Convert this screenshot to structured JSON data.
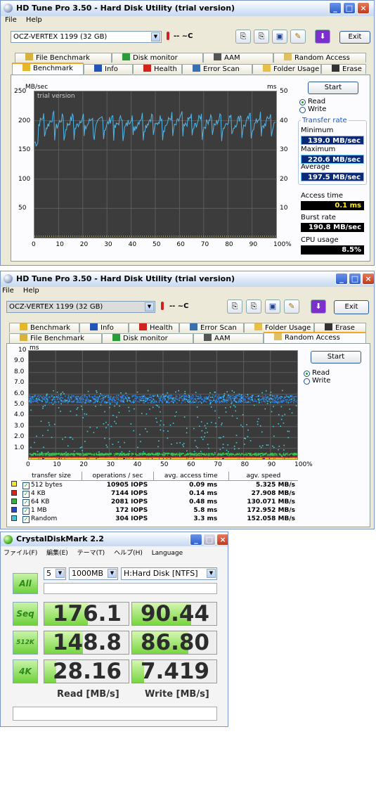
{
  "window1": {
    "title": "HD Tune Pro 3.50 - Hard Disk Utility (trial version)",
    "menu": [
      "File",
      "Help"
    ],
    "drive": "OCZ-VERTEX 1199 (32 GB)",
    "temperature": "-- ~C",
    "exit_label": "Exit",
    "tabs_top": [
      "File Benchmark",
      "Disk monitor",
      "AAM",
      "Random Access"
    ],
    "tabs_bottom": [
      "Benchmark",
      "Info",
      "Health",
      "Error Scan",
      "Folder Usage",
      "Erase"
    ],
    "chart_unit_left": "MB/sec",
    "chart_unit_right": "ms",
    "watermark": "trial version",
    "y_left_ticks": [
      "250",
      "200",
      "150",
      "100",
      "50"
    ],
    "y_right_ticks": [
      "50",
      "40",
      "30",
      "20",
      "10"
    ],
    "x_ticks": [
      "0",
      "10",
      "20",
      "30",
      "40",
      "50",
      "60",
      "70",
      "80",
      "90",
      "100%"
    ],
    "start_label": "Start",
    "read_label": "Read",
    "write_label": "Write",
    "mode_selected": "Read",
    "transfer_rate_label": "Transfer rate",
    "minimum_label": "Minimum",
    "minimum_value": "139.0 MB/sec",
    "maximum_label": "Maximum",
    "maximum_value": "220.6 MB/sec",
    "average_label": "Average",
    "average_value": "197.5 MB/sec",
    "access_time_label": "Access time",
    "access_time_value": "0.1 ms",
    "burst_rate_label": "Burst rate",
    "burst_rate_value": "190.8 MB/sec",
    "cpu_usage_label": "CPU usage",
    "cpu_usage_value": "8.5%"
  },
  "window2": {
    "title": "HD Tune Pro 3.50 - Hard Disk Utility (trial version)",
    "menu": [
      "File",
      "Help"
    ],
    "drive": "OCZ-VERTEX 1199 (32 GB)",
    "temperature": "-- ~C",
    "exit_label": "Exit",
    "tabs_top": [
      "Benchmark",
      "Info",
      "Health",
      "Error Scan",
      "Folder Usage",
      "Erase"
    ],
    "tabs_bottom": [
      "File Benchmark",
      "Disk monitor",
      "AAM",
      "Random Access"
    ],
    "chart_unit": "ms",
    "y_ticks": [
      "10",
      "9.0",
      "8.0",
      "7.0",
      "6.0",
      "5.0",
      "4.0",
      "3.0",
      "2.0",
      "1.0"
    ],
    "x_ticks": [
      "0",
      "10",
      "20",
      "30",
      "40",
      "50",
      "60",
      "70",
      "80",
      "90",
      "100%"
    ],
    "start_label": "Start",
    "read_label": "Read",
    "write_label": "Write",
    "mode_selected": "Read",
    "table_headers": [
      "transfer size",
      "operations / sec",
      "avg. access time",
      "agv. speed"
    ],
    "table_rows": [
      {
        "color": "#f7e03a",
        "size": "512 bytes",
        "ops": "10905 IOPS",
        "access": "0.09 ms",
        "speed": "5.325 MB/s"
      },
      {
        "color": "#d8241d",
        "size": "4 KB",
        "ops": "7144 IOPS",
        "access": "0.14 ms",
        "speed": "27.908 MB/s"
      },
      {
        "color": "#27b43a",
        "size": "64 KB",
        "ops": "2081 IOPS",
        "access": "0.48 ms",
        "speed": "130.071 MB/s"
      },
      {
        "color": "#2846c8",
        "size": "1 MB",
        "ops": "172 IOPS",
        "access": "5.8 ms",
        "speed": "172.952 MB/s"
      },
      {
        "color": "#35c9d6",
        "size": "Random",
        "ops": "304 IOPS",
        "access": "3.3 ms",
        "speed": "152.058 MB/s"
      }
    ]
  },
  "window3": {
    "title": "CrystalDiskMark 2.2",
    "menu": [
      "ファイル(F)",
      "編集(E)",
      "テーマ(T)",
      "ヘルプ(H)",
      "Language"
    ],
    "all_label": "All",
    "passes": "5",
    "size": "1000MB",
    "drive": "H:Hard Disk [NTFS]",
    "rows": [
      {
        "label": "Seq",
        "read": "176.1",
        "write": "90.44",
        "read_fill": 0.52,
        "write_fill": 0.7
      },
      {
        "label": "512K",
        "read": "148.8",
        "write": "86.80",
        "read_fill": 0.46,
        "write_fill": 0.67
      },
      {
        "label": "4K",
        "read": "28.16",
        "write": "7.419",
        "read_fill": 0.14,
        "write_fill": 0.14
      }
    ],
    "read_header": "Read [MB/s]",
    "write_header": "Write [MB/s]"
  },
  "colors": {
    "transfer_line": "#4fb6ea",
    "access_dots": "#f2e24a",
    "grid": "#5c5c5c",
    "scatter_blue": "#2f7fd8",
    "scatter_cyan": "#3fd0e6",
    "scatter_green": "#34c64a",
    "scatter_red": "#e03b2c",
    "scatter_yellow": "#f5e33a"
  }
}
